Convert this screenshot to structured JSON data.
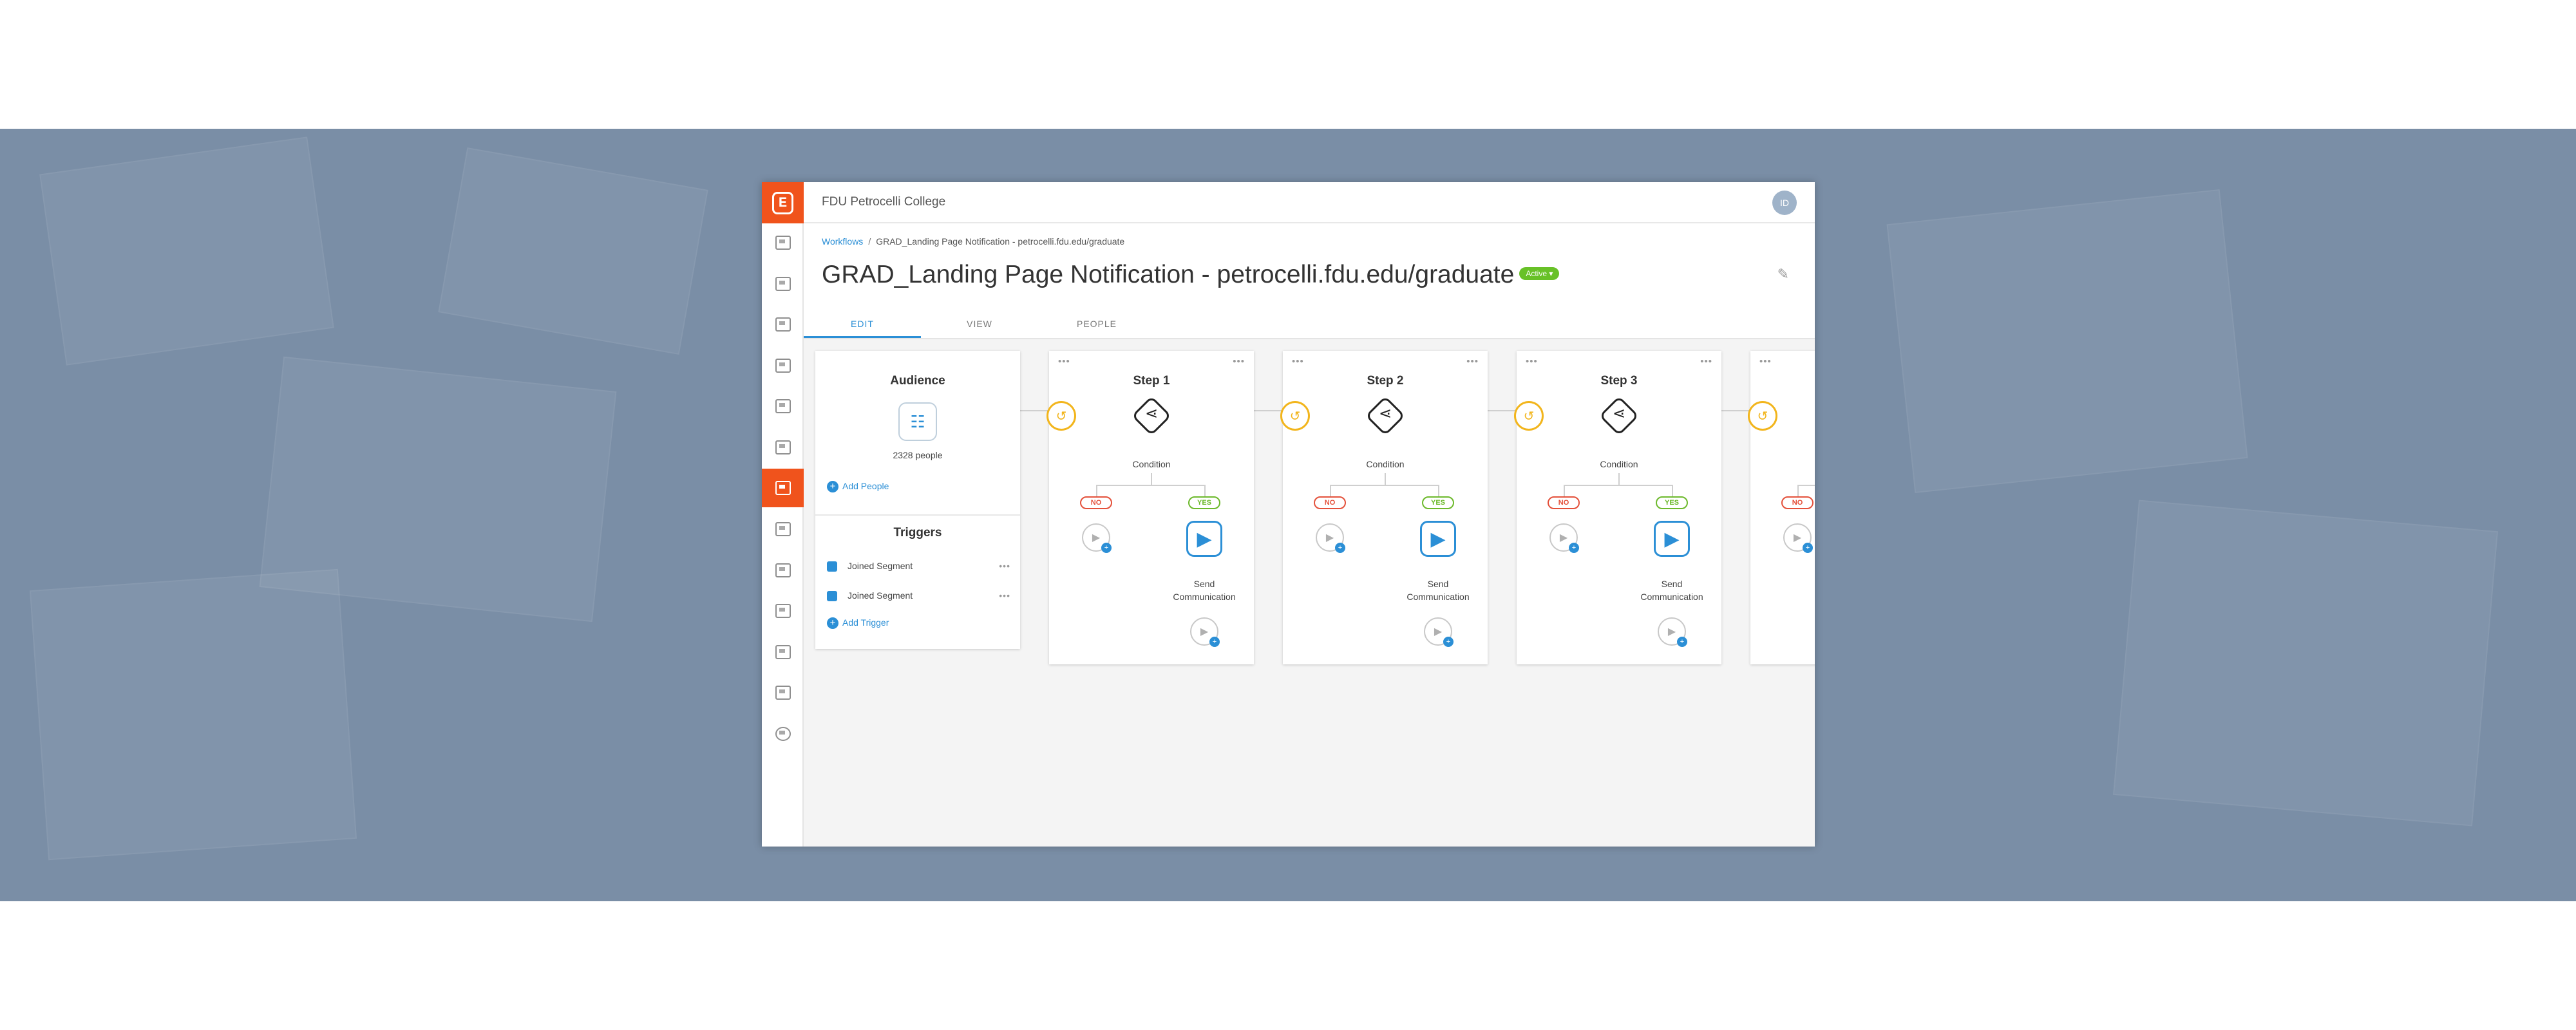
{
  "topbar": {
    "org_name": "FDU Petrocelli College",
    "avatar_initials": "ID",
    "logo_glyph": "E"
  },
  "breadcrumb": {
    "root": "Workflows",
    "separator": "/",
    "current": "GRAD_Landing Page Notification - petrocelli.fdu.edu/graduate"
  },
  "page": {
    "title": "GRAD_Landing Page Notification - petrocelli.fdu.edu/graduate",
    "status": "Active",
    "edit_icon": "pencil-icon"
  },
  "tabs": [
    {
      "label": "EDIT"
    },
    {
      "label": "VIEW"
    },
    {
      "label": "PEOPLE"
    }
  ],
  "sidebar": {
    "active_index": 6,
    "icons": [
      "grid-icon",
      "document-icon",
      "people-icon",
      "image-icon",
      "chat-icon",
      "mail-icon",
      "workflow-icon",
      "calendar-icon",
      "layout-icon",
      "list-icon",
      "chart-icon",
      "folder-icon",
      "gear-icon"
    ]
  },
  "audience": {
    "title": "Audience",
    "count": "2328 people",
    "add_people": "Add People"
  },
  "triggers": {
    "title": "Triggers",
    "items": [
      {
        "label": "Joined Segment"
      },
      {
        "label": "Joined Segment"
      }
    ],
    "add_trigger": "Add Trigger"
  },
  "steps": [
    {
      "title": "Step 1",
      "condition": "Condition",
      "no": "NO",
      "yes": "YES",
      "send_line1": "Send",
      "send_line2": "Communication"
    },
    {
      "title": "Step 2",
      "condition": "Condition",
      "no": "NO",
      "yes": "YES",
      "send_line1": "Send",
      "send_line2": "Communication"
    },
    {
      "title": "Step 3",
      "condition": "Condition",
      "no": "NO",
      "yes": "YES",
      "send_line1": "Send",
      "send_line2": "Communication"
    },
    {
      "title": "",
      "condition": "",
      "no": "NO",
      "yes": "",
      "send_line1": "",
      "send_line2": ""
    }
  ],
  "glyphs": {
    "more": "•••",
    "plus": "+",
    "play": "▶",
    "branch": "⋖",
    "clock": "↺",
    "people": "👥"
  },
  "colors": {
    "brand": "#f0531c",
    "link": "#2b8fd6",
    "active_badge": "#68c128",
    "no": "#e4503a",
    "yes": "#6cb92b",
    "delay": "#f2b51c"
  }
}
